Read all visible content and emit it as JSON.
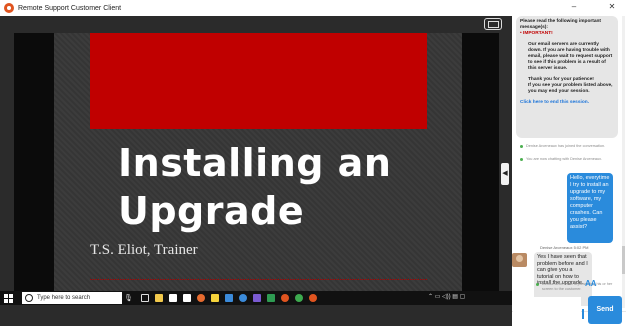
{
  "window": {
    "title": "Remote Support Customer Client",
    "minimize_glyph": "–",
    "close_glyph": "✕"
  },
  "slide": {
    "title": "Installing an Upgrade",
    "subtitle": "T.S. Eliot, Trainer",
    "accent_color": "#c00000"
  },
  "remote_taskbar": {
    "search_placeholder": "Type here to search"
  },
  "chat": {
    "notice": {
      "heading": "Please read the following important message(s):",
      "important_label": "• IMPORTANT!",
      "body": "Our email servers are currently down. If you are having trouble with email, please wait to request support to see if this problem is a result of this server issue.",
      "thanks": "Thank you for your patience!",
      "resolved": "If you see your problem listed above, you may end your session.",
      "end_link": "Click here to end this session."
    },
    "system_messages": [
      "Denise Arceneaux has joined the conversation.",
      "You are now chatting with Denise Arceneaux.",
      "Denise Arceneaux is presenting his or her screen to the customer."
    ],
    "customer_message": "Hello, everytime I try to install an upgrade to my software, my computer crashes. Can you please assist?",
    "agent": {
      "name": "Denise Arceneaux",
      "time": "5:02 PM",
      "message": "Yes I have seen that problem before and I can give you a tutorial on how to install the upgrade."
    },
    "font_size_label": "AA",
    "send_label": "Send",
    "accent_color": "#2a8bdc"
  }
}
